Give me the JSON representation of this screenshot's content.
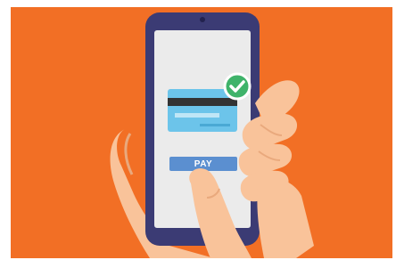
{
  "scene": {
    "background_color": "#f26f25",
    "phone_color": "#3b3b74",
    "screen_color": "#ebebeb",
    "card_color": "#6cc4ea",
    "card_stripe_color": "#333333",
    "check_badge_color": "#3fb36a",
    "skin_color": "#f9c39a",
    "skin_shadow_color": "#e9a97d",
    "check_icon": "check-icon"
  },
  "pay_button": {
    "label": "PAY",
    "color": "#5b8fd0"
  }
}
